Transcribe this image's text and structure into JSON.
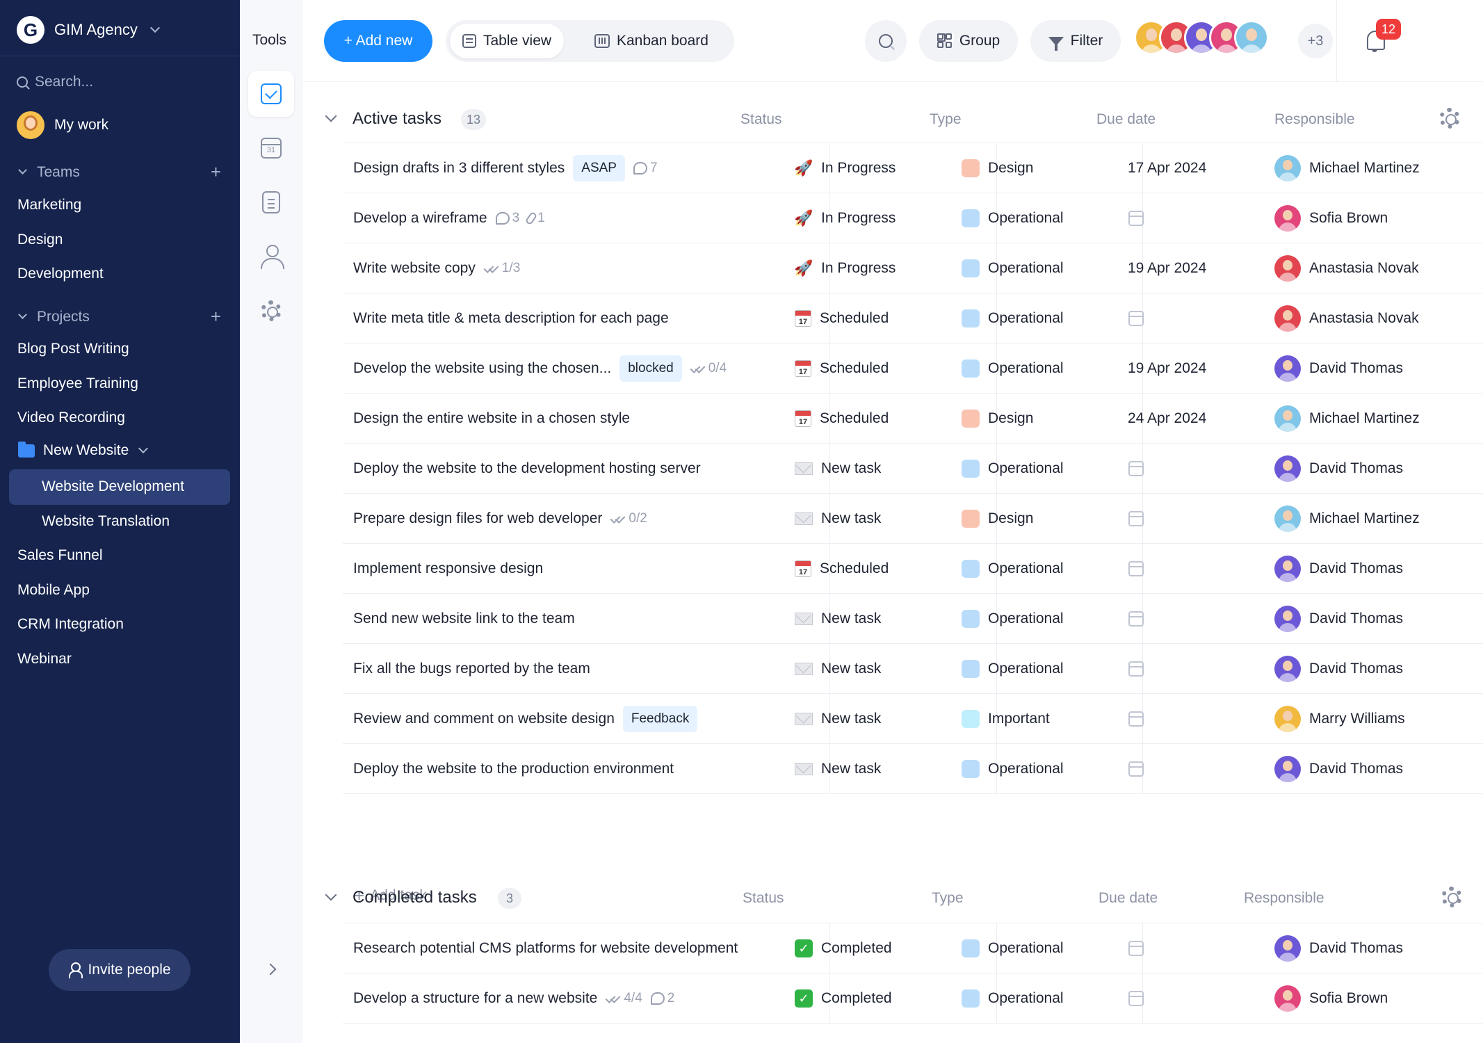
{
  "workspace": {
    "name": "GIM Agency",
    "logo_letter": "G"
  },
  "sidebar": {
    "search_placeholder": "Search...",
    "my_work": "My work",
    "teams_label": "Teams",
    "teams": [
      "Marketing",
      "Design",
      "Development"
    ],
    "projects_label": "Projects",
    "projects": [
      "Blog Post Writing",
      "Employee Training",
      "Video Recording"
    ],
    "folder": {
      "label": "New Website",
      "children": [
        "Website Development",
        "Website Translation"
      ],
      "active": "Website Development"
    },
    "more_projects": [
      "Sales Funnel",
      "Mobile App",
      "CRM Integration",
      "Webinar"
    ],
    "invite_label": "Invite people"
  },
  "tools": {
    "title": "Tools",
    "items": [
      "check-icon",
      "calendar-icon",
      "document-icon",
      "user-icon",
      "gear-icon"
    ],
    "calendar_day": "31"
  },
  "toolbar": {
    "add_new": "+ Add new",
    "views": [
      "Table view",
      "Kanban board"
    ],
    "active_view": "Table view",
    "group": "Group",
    "filter": "Filter",
    "more_members": "+3",
    "notifications": "12"
  },
  "columns": {
    "status": "Status",
    "type": "Type",
    "due": "Due date",
    "responsible": "Responsible"
  },
  "colors": {
    "accent": "#1a8cff",
    "sidebar_bg": "#15234d",
    "type_design": "#f9c3b0",
    "type_operational": "#b9dcfb",
    "type_important": "#bfeefc",
    "badge": "#f03b3b"
  },
  "active": {
    "title": "Active tasks",
    "count": "13",
    "add_task": "Add task",
    "tasks": [
      {
        "name": "Design drafts in 3 different styles",
        "tag": "ASAP",
        "meta": [
          {
            "icon": "comment",
            "value": "7"
          }
        ],
        "status": "In Progress",
        "status_icon": "rocket",
        "type": "Design",
        "due": "17 Apr 2024",
        "resp": "Michael Martinez",
        "avatar_color": "#7fc6e8"
      },
      {
        "name": "Develop a wireframe",
        "tag": "",
        "meta": [
          {
            "icon": "comment",
            "value": "3"
          },
          {
            "icon": "clip",
            "value": "1"
          }
        ],
        "status": "In Progress",
        "status_icon": "rocket",
        "type": "Operational",
        "due": "",
        "resp": "Sofia Brown",
        "avatar_color": "#e2457b"
      },
      {
        "name": "Write website copy",
        "tag": "",
        "meta": [
          {
            "icon": "checks",
            "value": "1/3"
          }
        ],
        "status": "In Progress",
        "status_icon": "rocket",
        "type": "Operational",
        "due": "19 Apr 2024",
        "resp": "Anastasia Novak",
        "avatar_color": "#e2454f"
      },
      {
        "name": "Write meta title & meta description for each page",
        "tag": "",
        "meta": [],
        "status": "Scheduled",
        "status_icon": "calendar",
        "type": "Operational",
        "due": "",
        "resp": "Anastasia Novak",
        "avatar_color": "#e2454f"
      },
      {
        "name": "Develop the website using the chosen...",
        "tag": "blocked",
        "meta": [
          {
            "icon": "checks",
            "value": "0/4"
          }
        ],
        "status": "Scheduled",
        "status_icon": "calendar",
        "type": "Operational",
        "due": "19 Apr 2024",
        "resp": "David Thomas",
        "avatar_color": "#6b58d6"
      },
      {
        "name": "Design the entire website in a chosen style",
        "tag": "",
        "meta": [],
        "status": "Scheduled",
        "status_icon": "calendar",
        "type": "Design",
        "due": "24 Apr 2024",
        "resp": "Michael Martinez",
        "avatar_color": "#7fc6e8"
      },
      {
        "name": "Deploy the website to the development hosting server",
        "tag": "",
        "meta": [],
        "status": "New task",
        "status_icon": "envelope",
        "type": "Operational",
        "due": "",
        "resp": "David Thomas",
        "avatar_color": "#6b58d6"
      },
      {
        "name": "Prepare design files for web developer",
        "tag": "",
        "meta": [
          {
            "icon": "checks",
            "value": "0/2"
          }
        ],
        "status": "New task",
        "status_icon": "envelope",
        "type": "Design",
        "due": "",
        "resp": "Michael Martinez",
        "avatar_color": "#7fc6e8"
      },
      {
        "name": "Implement responsive design",
        "tag": "",
        "meta": [],
        "status": "Scheduled",
        "status_icon": "calendar",
        "type": "Operational",
        "due": "",
        "resp": "David Thomas",
        "avatar_color": "#6b58d6"
      },
      {
        "name": "Send new website link to the team",
        "tag": "",
        "meta": [],
        "status": "New task",
        "status_icon": "envelope",
        "type": "Operational",
        "due": "",
        "resp": "David Thomas",
        "avatar_color": "#6b58d6"
      },
      {
        "name": "Fix all the bugs reported by the team",
        "tag": "",
        "meta": [],
        "status": "New task",
        "status_icon": "envelope",
        "type": "Operational",
        "due": "",
        "resp": "David Thomas",
        "avatar_color": "#6b58d6"
      },
      {
        "name": "Review and comment on website design",
        "tag": "Feedback",
        "meta": [],
        "status": "New task",
        "status_icon": "envelope",
        "type": "Important",
        "due": "",
        "resp": "Marry Williams",
        "avatar_color": "#f2b93f"
      },
      {
        "name": "Deploy the website to the production environment",
        "tag": "",
        "meta": [],
        "status": "New task",
        "status_icon": "envelope",
        "type": "Operational",
        "due": "",
        "resp": "David Thomas",
        "avatar_color": "#6b58d6"
      }
    ]
  },
  "completed": {
    "title": "Completed tasks",
    "count": "3",
    "tasks": [
      {
        "name": "Research potential CMS platforms for website development",
        "tag": "",
        "meta": [],
        "status": "Completed",
        "status_icon": "done",
        "type": "Operational",
        "due": "",
        "resp": "David Thomas",
        "avatar_color": "#6b58d6"
      },
      {
        "name": "Develop a structure for a new website",
        "tag": "",
        "meta": [
          {
            "icon": "checks",
            "value": "4/4"
          },
          {
            "icon": "comment",
            "value": "2"
          }
        ],
        "status": "Completed",
        "status_icon": "done",
        "type": "Operational",
        "due": "",
        "resp": "Sofia Brown",
        "avatar_color": "#e2457b"
      }
    ]
  },
  "team_avatar_colors": [
    "#f2b93f",
    "#e2454f",
    "#6b58d6",
    "#e2457b",
    "#7fc6e8"
  ]
}
